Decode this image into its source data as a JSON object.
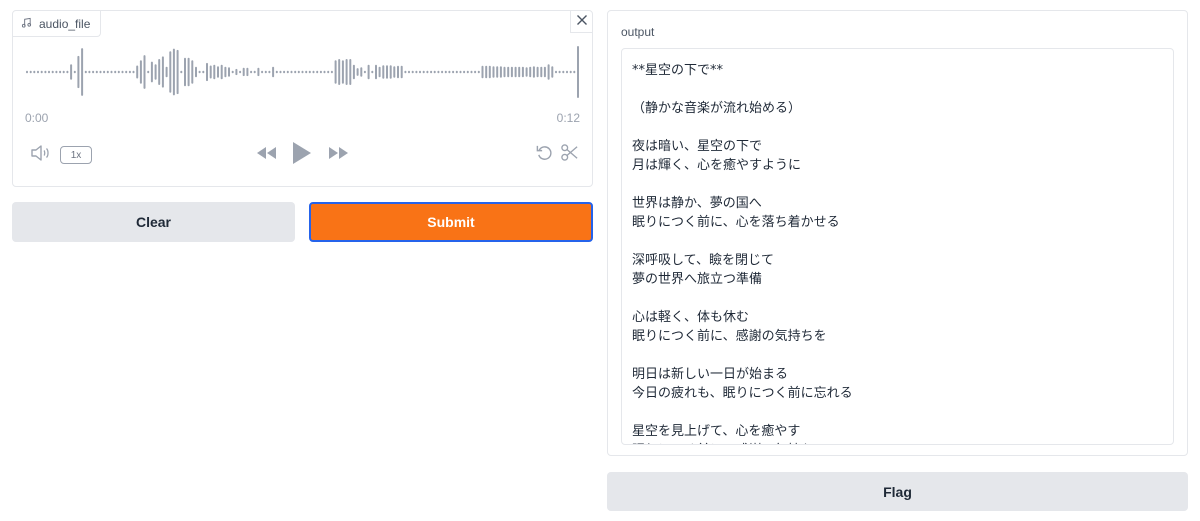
{
  "audio": {
    "label": "audio_file",
    "label_icon": "music-note-icon",
    "close_icon": "close-icon",
    "time_start": "0:00",
    "time_end": "0:12",
    "playback_rate": "1x",
    "waveform_amplitudes": [
      0.05,
      0.05,
      0.05,
      0.05,
      0.05,
      0.05,
      0.05,
      0.05,
      0.05,
      0.05,
      0.05,
      0.05,
      0.3,
      0.05,
      0.62,
      0.92,
      0.05,
      0.05,
      0.05,
      0.05,
      0.05,
      0.05,
      0.05,
      0.05,
      0.05,
      0.05,
      0.05,
      0.05,
      0.05,
      0.05,
      0.25,
      0.45,
      0.65,
      0.05,
      0.4,
      0.3,
      0.5,
      0.6,
      0.2,
      0.8,
      0.9,
      0.85,
      0.05,
      0.55,
      0.55,
      0.45,
      0.2,
      0.05,
      0.05,
      0.35,
      0.25,
      0.28,
      0.22,
      0.28,
      0.2,
      0.18,
      0.05,
      0.12,
      0.05,
      0.16,
      0.16,
      0.05,
      0.05,
      0.16,
      0.05,
      0.05,
      0.05,
      0.2,
      0.05,
      0.05,
      0.05,
      0.05,
      0.05,
      0.05,
      0.05,
      0.05,
      0.05,
      0.05,
      0.05,
      0.05,
      0.05,
      0.05,
      0.05,
      0.05,
      0.45,
      0.5,
      0.45,
      0.5,
      0.5,
      0.28,
      0.15,
      0.18,
      0.05,
      0.28,
      0.05,
      0.28,
      0.2,
      0.26,
      0.26,
      0.26,
      0.22,
      0.24,
      0.24,
      0.05,
      0.05,
      0.05,
      0.05,
      0.05,
      0.05,
      0.05,
      0.05,
      0.05,
      0.05,
      0.05,
      0.05,
      0.05,
      0.05,
      0.05,
      0.05,
      0.05,
      0.05,
      0.05,
      0.05,
      0.05,
      0.24,
      0.24,
      0.24,
      0.22,
      0.22,
      0.22,
      0.2,
      0.2,
      0.2,
      0.2,
      0.2,
      0.2,
      0.18,
      0.2,
      0.22,
      0.2,
      0.2,
      0.2,
      0.3,
      0.22,
      0.05,
      0.05,
      0.05,
      0.05,
      0.05,
      0.05,
      1.0
    ]
  },
  "controls": {
    "volume_icon": "volume-icon",
    "rewind_icon": "rewind-icon",
    "play_icon": "play-icon",
    "forward_icon": "fast-forward-icon",
    "reset_icon": "undo-icon",
    "trim_icon": "scissors-icon"
  },
  "buttons": {
    "clear": "Clear",
    "submit": "Submit",
    "flag": "Flag"
  },
  "output": {
    "label": "output",
    "text": "**星空の下で**\n\n（静かな音楽が流れ始める）\n\n夜は暗い、星空の下で\n月は輝く、心を癒やすように\n\n世界は静か、夢の国へ\n眠りにつく前に、心を落ち着かせる\n\n深呼吸して、瞼を閉じて\n夢の世界へ旅立つ準備\n\n心は軽く、体も休む\n眠りにつく前に、感謝の気持ちを\n\n明日は新しい一日が始まる\n今日の疲れも、眠りにつく前に忘れる\n\n星空を見上げて、心を癒やす\n眠りにつく前に、感謝の気持ちで"
  },
  "colors": {
    "accent": "#f97316",
    "focus_border": "#2563eb",
    "waveform": "#9ca3af",
    "button_bg": "#e5e7eb"
  }
}
